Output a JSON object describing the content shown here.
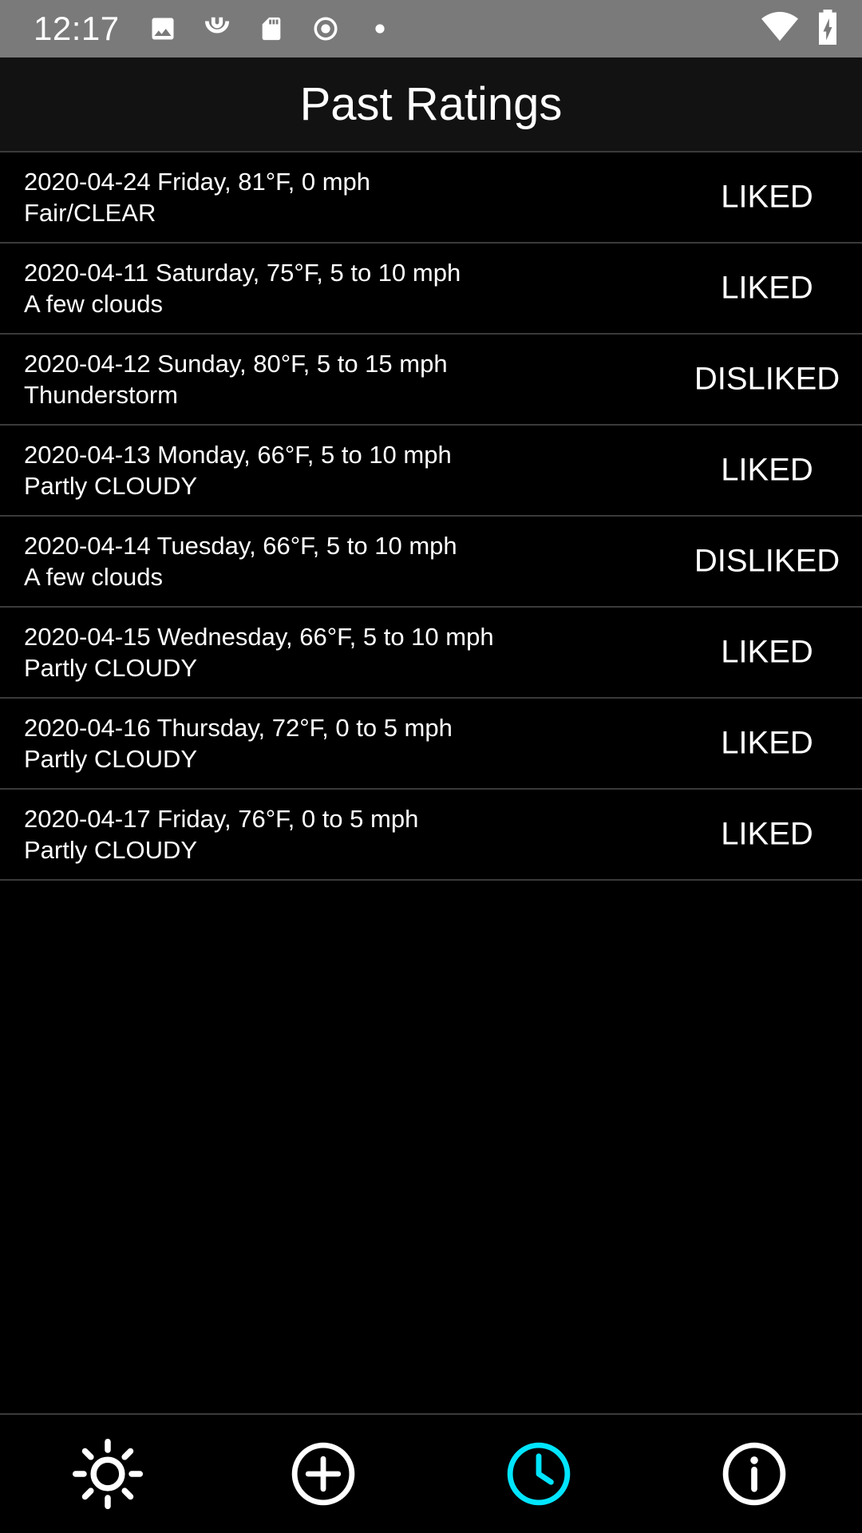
{
  "status_bar": {
    "time": "12:17",
    "icons": [
      "image-icon",
      "arc-icon",
      "sd-card-icon",
      "record-icon",
      "dot-icon",
      "wifi-icon",
      "battery-charging-icon"
    ]
  },
  "header": {
    "title": "Past Ratings"
  },
  "ratings": [
    {
      "line1": "2020-04-24 Friday, 81°F, 0 mph",
      "line2": "Fair/CLEAR",
      "rating": "LIKED"
    },
    {
      "line1": "2020-04-11 Saturday, 75°F, 5 to 10 mph",
      "line2": "A few clouds",
      "rating": "LIKED"
    },
    {
      "line1": "2020-04-12 Sunday, 80°F, 5 to 15 mph",
      "line2": "Thunderstorm",
      "rating": "DISLIKED"
    },
    {
      "line1": "2020-04-13 Monday, 66°F, 5 to 10 mph",
      "line2": "Partly CLOUDY",
      "rating": "LIKED"
    },
    {
      "line1": "2020-04-14 Tuesday, 66°F, 5 to 10 mph",
      "line2": "A few clouds",
      "rating": "DISLIKED"
    },
    {
      "line1": "2020-04-15 Wednesday, 66°F, 5 to 10 mph",
      "line2": "Partly CLOUDY",
      "rating": "LIKED"
    },
    {
      "line1": "2020-04-16 Thursday, 72°F, 0 to 5 mph",
      "line2": "Partly CLOUDY",
      "rating": "LIKED"
    },
    {
      "line1": "2020-04-17 Friday, 76°F, 0 to 5 mph",
      "line2": "Partly CLOUDY",
      "rating": "LIKED"
    }
  ],
  "bottom_nav": {
    "items": [
      {
        "icon": "sun-icon",
        "active": false
      },
      {
        "icon": "add-circle-icon",
        "active": false
      },
      {
        "icon": "clock-icon",
        "active": true
      },
      {
        "icon": "info-icon",
        "active": false
      }
    ]
  },
  "colors": {
    "accent": "#00e5ff",
    "background": "#000000",
    "title_bar": "#121212",
    "status_bar": "#7a7a7a",
    "divider": "#3a3a3a",
    "text": "#ffffff"
  }
}
